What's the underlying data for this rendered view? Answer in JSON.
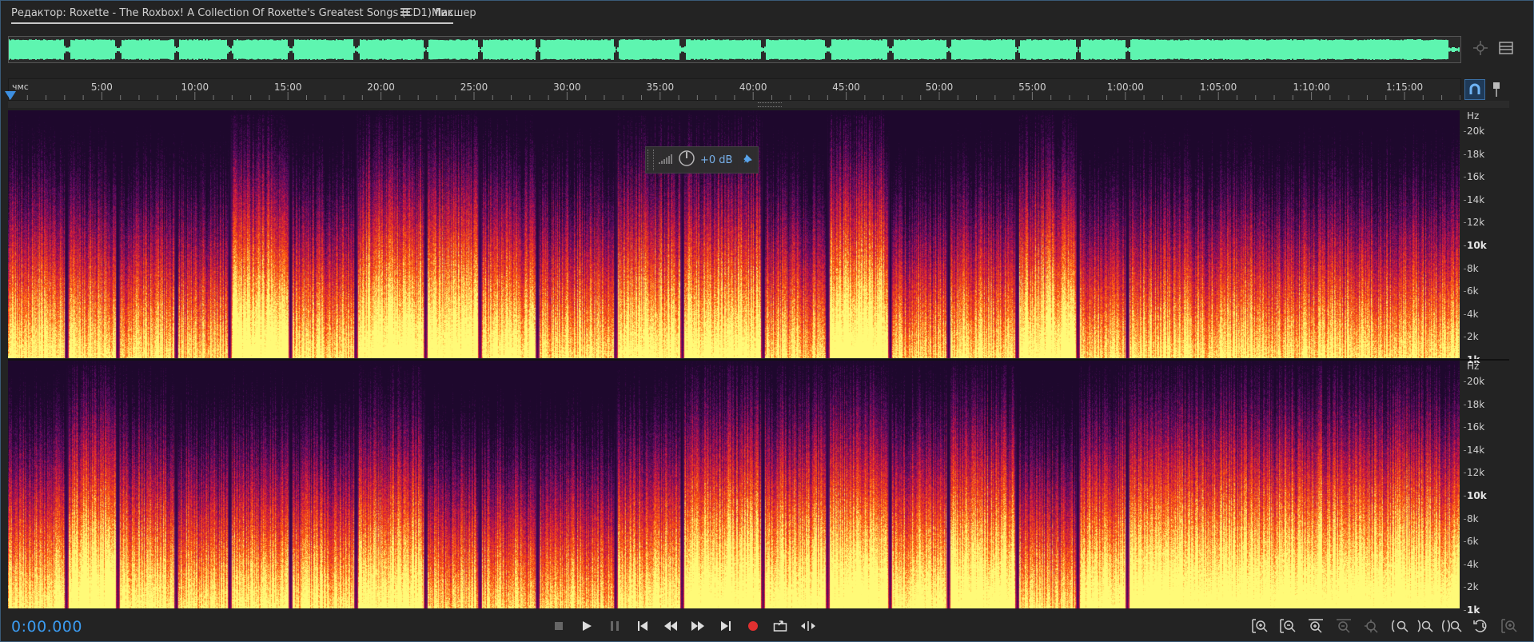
{
  "tabs": [
    {
      "label": "Редактор: Roxette - The Roxbox! A Collection Of Roxette's Greatest Songs (CD1).flac",
      "active": true
    },
    {
      "label": "Микшер",
      "active": false
    }
  ],
  "ruler": {
    "unit": "чмс",
    "ticks": [
      "5:00",
      "10:00",
      "15:00",
      "20:00",
      "25:00",
      "30:00",
      "35:00",
      "40:00",
      "45:00",
      "50:00",
      "55:00",
      "1:00:00",
      "1:05:00",
      "1:10:00",
      "1:15:00"
    ]
  },
  "freq_axis": {
    "unit": "Hz",
    "labels": [
      "20k",
      "18k",
      "16k",
      "14k",
      "12k",
      "10k",
      "8k",
      "6k",
      "4k",
      "2k",
      "1k"
    ],
    "bold": [
      "10k",
      "1k"
    ]
  },
  "hud": {
    "gain": "+0 dB"
  },
  "time_display": "0:00.000",
  "colors": {
    "accent": "#3b9bf0",
    "waveform": "#5ef5b0",
    "record": "#e03030"
  },
  "transport": [
    "stop-icon",
    "play-icon",
    "pause-icon",
    "skip-to-start-icon",
    "rewind-icon",
    "fast-forward-icon",
    "skip-to-end-icon",
    "record-icon",
    "loop-icon",
    "skip-selection-icon"
  ],
  "zoom_tools": [
    "zoom-in-amplitude-icon",
    "zoom-out-amplitude-icon",
    "zoom-in-time-icon",
    "zoom-out-time-icon",
    "zoom-full-icon",
    "zoom-in-left-icon",
    "zoom-in-right-icon",
    "zoom-selection-icon",
    "zoom-reset-icon",
    "zoom-tracks-icon"
  ]
}
